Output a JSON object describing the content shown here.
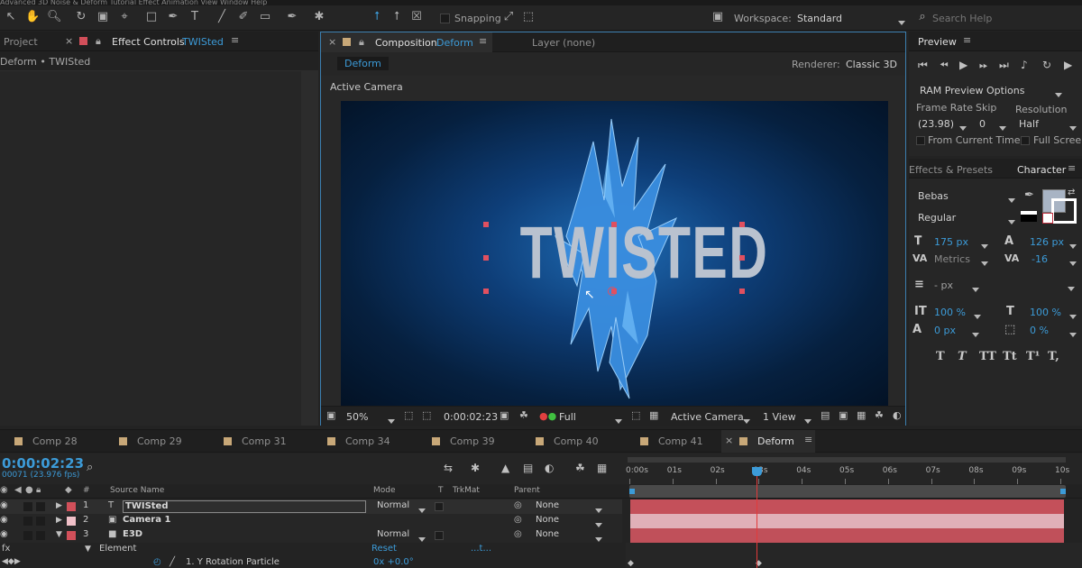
{
  "window_title": "Advanced 3D Noise & Deform Tutorial   Effect   Animation   View   Window   Help",
  "toolbar": {
    "snapping_label": "Snapping",
    "workspace_label": "Workspace:",
    "workspace_value": "Standard",
    "search_placeholder": "Search Help"
  },
  "left_panel": {
    "project_tab": "Project",
    "effect_controls_label": "Effect Controls",
    "effect_controls_target": "TWISted",
    "breadcrumb": "Deform • TWISted"
  },
  "comp_panel": {
    "tab_label": "Composition",
    "tab_target": "Deform",
    "layer_tab": "Layer (none)",
    "comp_button": "Deform",
    "renderer_label": "Renderer:",
    "renderer_value": "Classic 3D",
    "view_label": "Active Camera",
    "viewer_title_text": "TWISTED",
    "footer": {
      "zoom": "50%",
      "timecode": "0:00:02:23",
      "resolution": "Full",
      "camera": "Active Camera",
      "views": "1 View"
    }
  },
  "preview_panel": {
    "title": "Preview",
    "ram_preview": "RAM Preview Options",
    "frame_rate_label": "Frame Rate",
    "skip_label": "Skip",
    "resolution_label": "Resolution",
    "frame_rate_value": "(23.98)",
    "skip_value": "0",
    "resolution_value": "Half",
    "from_current_time": "From Current Time",
    "full_screen": "Full Screen"
  },
  "character_panel": {
    "effects_tab": "Effects & Presets",
    "title": "Character",
    "font": "Bebas",
    "style": "Regular",
    "font_size": "175 px",
    "leading": "126 px",
    "kerning": "Metrics",
    "tracking": "-16",
    "stroke_width": "- px",
    "vertical_scale": "100 %",
    "horizontal_scale": "100 %",
    "baseline_shift": "0 px",
    "tsume": "0 %",
    "style_buttons": [
      "T",
      "T",
      "TT",
      "Tt",
      "T¹",
      "T,"
    ],
    "fill_color": "#a8b4c4",
    "stroke_color": "#ffffff"
  },
  "comp_tabs": [
    {
      "label": "Comp 28",
      "color": "#c8a878"
    },
    {
      "label": "Comp 29",
      "color": "#c8a878"
    },
    {
      "label": "Comp 31",
      "color": "#c8a878"
    },
    {
      "label": "Comp 34",
      "color": "#c8a878"
    },
    {
      "label": "Comp 39",
      "color": "#c8a878"
    },
    {
      "label": "Comp 40",
      "color": "#c8a878"
    },
    {
      "label": "Comp 41",
      "color": "#c8a878"
    },
    {
      "label": "Deform",
      "color": "#c8a878"
    }
  ],
  "timeline": {
    "timecode": "0:00:02:23",
    "frames": "00071 (23.976 fps)",
    "columns": {
      "num": "#",
      "source_name": "Source Name",
      "mode": "Mode",
      "t": "T",
      "trkmat": "TrkMat",
      "parent": "Parent"
    },
    "ruler_ticks": [
      "0:00s",
      "01s",
      "02s",
      "03s",
      "04s",
      "05s",
      "06s",
      "07s",
      "08s",
      "09s",
      "10s"
    ],
    "playhead_seconds": 2.96,
    "layers": [
      {
        "num": "1",
        "name": "TWISted",
        "mode": "Normal",
        "parent": "None",
        "color": "#d2505a",
        "track_color": "#c4505a"
      },
      {
        "num": "2",
        "name": "Camera 1",
        "mode": "",
        "parent": "None",
        "color": "#f0c0c8",
        "track_color": "#e0b0b8"
      },
      {
        "num": "3",
        "name": "E3D",
        "mode": "Normal",
        "parent": "None",
        "color": "#d2505a",
        "track_color": "#c0505a"
      }
    ],
    "element_label": "Element",
    "reset_label": "Reset",
    "reset_dots": "...t...",
    "property_label": "1. Y Rotation Particle",
    "property_value": "0x +0.0°"
  }
}
